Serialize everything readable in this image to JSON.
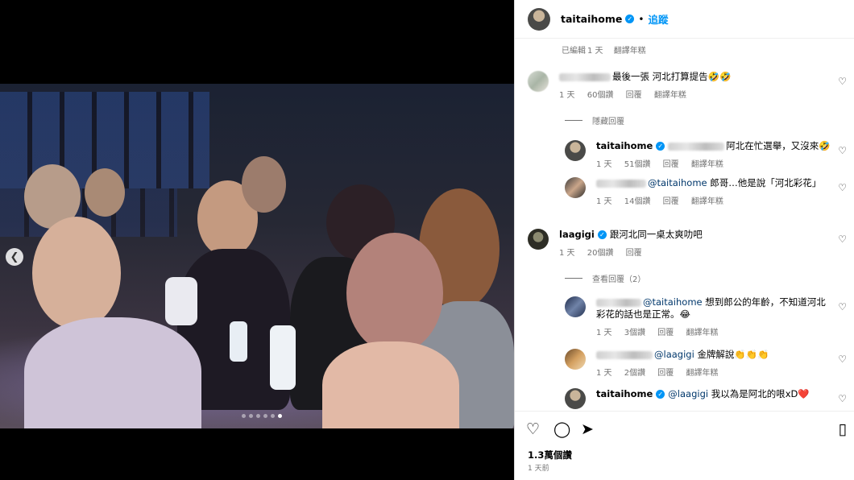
{
  "post": {
    "username": "taitaihome",
    "follow_label": "追蹤",
    "separator": "•",
    "edited_label": "已編輯",
    "edited_time": "1 天",
    "translate_label": "翻譯年糕"
  },
  "comments": [
    {
      "user": "",
      "text": "最後一張 河北打算提告🤣🤣",
      "time": "1 天",
      "likes": "60個讚",
      "reply": "回覆",
      "translate": "翻譯年糕"
    },
    {
      "user": "taitaihome",
      "verified": true,
      "text": "阿北在忙選舉，又沒來🤣",
      "time": "1 天",
      "likes": "51個讚",
      "reply": "回覆",
      "translate": "翻譯年糕"
    },
    {
      "user": "",
      "mention": "@taitaihome",
      "text": "郎哥…他是說「河北彩花」",
      "time": "1 天",
      "likes": "14個讚",
      "reply": "回覆",
      "translate": "翻譯年糕"
    },
    {
      "user": "laagigi",
      "verified": true,
      "text": "跟河北同一桌太爽叻吧",
      "time": "1 天",
      "likes": "20個讚",
      "reply": "回覆"
    },
    {
      "user": "",
      "mention": "@taitaihome",
      "text": "想到郎公的年齡，不知道河北",
      "text2": "彩花的話也是正常。😂",
      "time": "1 天",
      "likes": "3個讚",
      "reply": "回覆",
      "translate": "翻譯年糕"
    },
    {
      "user": "",
      "mention": "@laagigi",
      "text": "金牌解說👏👏👏",
      "time": "1 天",
      "likes": "2個讚",
      "reply": "回覆",
      "translate": "翻譯年糕"
    },
    {
      "user": "taitaihome",
      "verified": true,
      "mention": "@laagigi",
      "text": "我以為是阿北的哏xD❤️"
    }
  ],
  "hide_replies": "隱藏回覆",
  "view_replies": "查看回覆（2）",
  "engagement": {
    "likes": "1.3萬個讚",
    "time": "1 天前"
  },
  "icons": {
    "like": "heart-icon",
    "comment": "comment-icon",
    "share": "share-icon",
    "save": "bookmark-icon",
    "prev": "chevron-left-icon"
  },
  "colors": {
    "accent": "#0095f6",
    "muted": "#737373",
    "mention": "#00376b"
  }
}
